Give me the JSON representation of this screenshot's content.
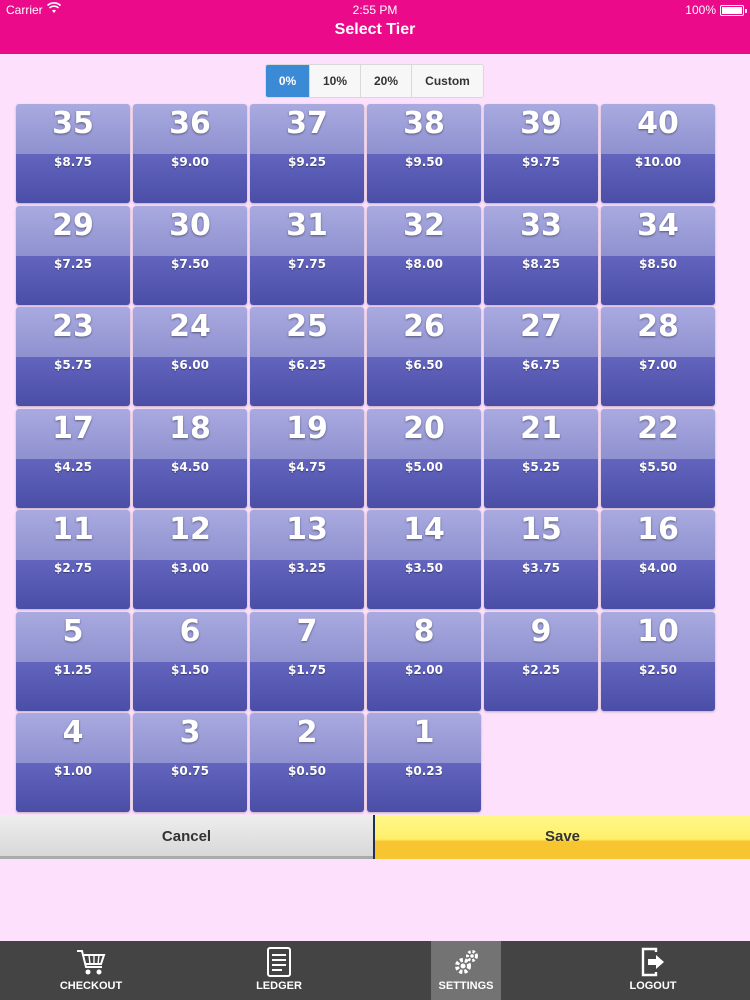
{
  "status_bar": {
    "carrier": "Carrier",
    "time": "2:55 PM",
    "battery": "100%"
  },
  "nav": {
    "title": "Select Tier"
  },
  "segments": [
    {
      "label": "0%",
      "active": true
    },
    {
      "label": "10%",
      "active": false
    },
    {
      "label": "20%",
      "active": false
    },
    {
      "label": "Custom",
      "active": false
    }
  ],
  "tiers": [
    {
      "num": "35",
      "price": "$8.75"
    },
    {
      "num": "36",
      "price": "$9.00"
    },
    {
      "num": "37",
      "price": "$9.25"
    },
    {
      "num": "38",
      "price": "$9.50"
    },
    {
      "num": "39",
      "price": "$9.75"
    },
    {
      "num": "40",
      "price": "$10.00"
    },
    {
      "num": "29",
      "price": "$7.25"
    },
    {
      "num": "30",
      "price": "$7.50"
    },
    {
      "num": "31",
      "price": "$7.75"
    },
    {
      "num": "32",
      "price": "$8.00"
    },
    {
      "num": "33",
      "price": "$8.25"
    },
    {
      "num": "34",
      "price": "$8.50"
    },
    {
      "num": "23",
      "price": "$5.75"
    },
    {
      "num": "24",
      "price": "$6.00"
    },
    {
      "num": "25",
      "price": "$6.25"
    },
    {
      "num": "26",
      "price": "$6.50"
    },
    {
      "num": "27",
      "price": "$6.75"
    },
    {
      "num": "28",
      "price": "$7.00"
    },
    {
      "num": "17",
      "price": "$4.25"
    },
    {
      "num": "18",
      "price": "$4.50"
    },
    {
      "num": "19",
      "price": "$4.75"
    },
    {
      "num": "20",
      "price": "$5.00"
    },
    {
      "num": "21",
      "price": "$5.25"
    },
    {
      "num": "22",
      "price": "$5.50"
    },
    {
      "num": "11",
      "price": "$2.75"
    },
    {
      "num": "12",
      "price": "$3.00"
    },
    {
      "num": "13",
      "price": "$3.25"
    },
    {
      "num": "14",
      "price": "$3.50"
    },
    {
      "num": "15",
      "price": "$3.75"
    },
    {
      "num": "16",
      "price": "$4.00"
    },
    {
      "num": "5",
      "price": "$1.25"
    },
    {
      "num": "6",
      "price": "$1.50"
    },
    {
      "num": "7",
      "price": "$1.75"
    },
    {
      "num": "8",
      "price": "$2.00"
    },
    {
      "num": "9",
      "price": "$2.25"
    },
    {
      "num": "10",
      "price": "$2.50"
    },
    {
      "num": "4",
      "price": "$1.00"
    },
    {
      "num": "3",
      "price": "$0.75"
    },
    {
      "num": "2",
      "price": "$0.50"
    },
    {
      "num": "1",
      "price": "$0.23"
    }
  ],
  "actions": {
    "cancel": "Cancel",
    "save": "Save"
  },
  "tabs": [
    {
      "label": "CHECKOUT",
      "icon": "cart-icon",
      "active": false
    },
    {
      "label": "LEDGER",
      "icon": "ledger-icon",
      "active": false
    },
    {
      "label": "SETTINGS",
      "icon": "gears-icon",
      "active": true
    },
    {
      "label": "LOGOUT",
      "icon": "logout-icon",
      "active": false
    }
  ],
  "colors": {
    "brand": "#ea0a8a",
    "background": "#fde0fb",
    "segment_active": "#3a8ad6",
    "tile_top": "#9b9dd8",
    "tile_bottom": "#5255b2",
    "save": "#f7c530",
    "tab_bar": "#444444"
  }
}
